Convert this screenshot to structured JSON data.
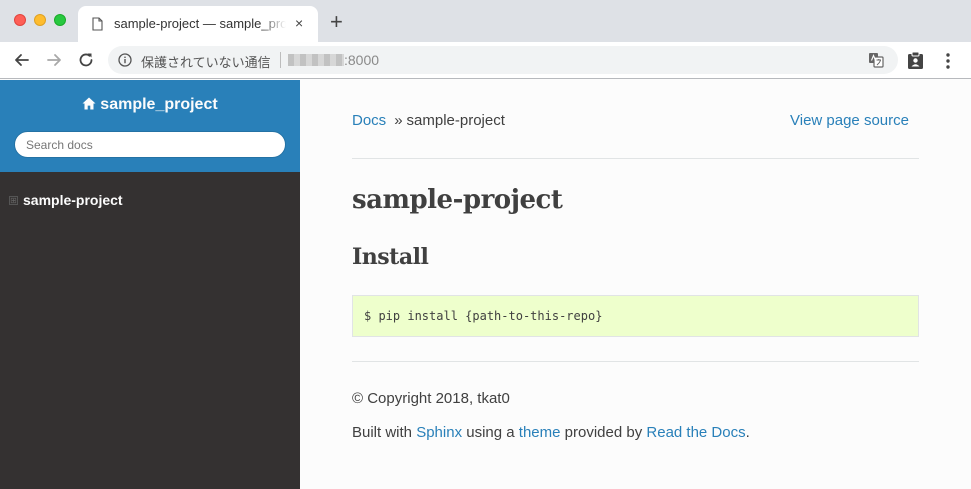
{
  "browser": {
    "tab_title": "sample-project — sample_project documentation",
    "tab_close": "×",
    "new_tab": "+",
    "security_label": "保護されていない通信",
    "url_visible": ":8000"
  },
  "sidebar": {
    "project_name": "sample_project",
    "search_placeholder": "Search docs",
    "toc": [
      {
        "expander": "⊞",
        "label": "sample-project"
      }
    ]
  },
  "content": {
    "breadcrumb_root": "Docs",
    "breadcrumb_separator": "»",
    "breadcrumb_current": "sample-project",
    "view_source": "View page source",
    "title": "sample-project",
    "section_heading": "Install",
    "code": "$ pip install {path-to-this-repo}"
  },
  "footer": {
    "copyright": "© Copyright 2018, tkat0",
    "built_prefix": "Built with ",
    "sphinx": "Sphinx",
    "using_a": " using a ",
    "theme": "theme",
    "provided_by": " provided by ",
    "rtd": "Read the Docs",
    "period": "."
  },
  "colors": {
    "accent": "#2980b9",
    "sidebar_bg": "#343131",
    "code_bg": "#eeffcc",
    "text": "#404040"
  }
}
